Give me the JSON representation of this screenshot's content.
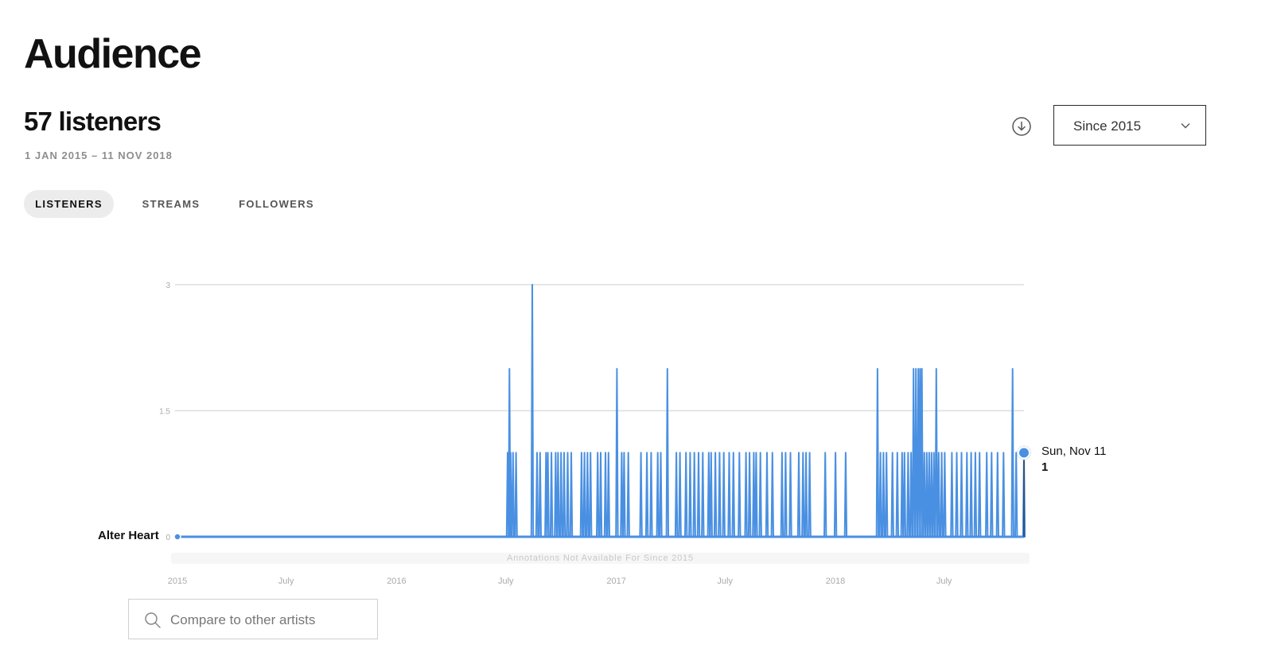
{
  "page": {
    "title": "Audience"
  },
  "summary": {
    "metric": "57 listeners",
    "date_range": "1 JAN 2015 – 11 NOV 2018"
  },
  "toolbar": {
    "download_icon": "download-circle-icon",
    "range_select": {
      "value": "Since 2015",
      "icon": "chevron-down-icon"
    }
  },
  "tabs": [
    {
      "label": "LISTENERS",
      "active": true
    },
    {
      "label": "STREAMS",
      "active": false
    },
    {
      "label": "FOLLOWERS",
      "active": false
    }
  ],
  "chart": {
    "series_label": "Alter Heart",
    "tooltip": {
      "date": "Sun, Nov 11",
      "value": "1"
    },
    "annotation_note": "Annotations Not Available For Since 2015"
  },
  "compare": {
    "placeholder": "Compare to other artists",
    "icon": "search-icon"
  },
  "colors": {
    "accent": "#4a90e2",
    "grid": "#dddddd",
    "text": "#181818"
  },
  "chart_data": {
    "type": "line",
    "title": "",
    "xlabel": "",
    "ylabel": "",
    "ylim": [
      0,
      3
    ],
    "y_ticks": [
      "0",
      "1.5",
      "3"
    ],
    "x_ticks": [
      "2015",
      "July",
      "2016",
      "July",
      "2017",
      "July",
      "2018",
      "July"
    ],
    "x_range": [
      "2015-01-01",
      "2018-11-11"
    ],
    "grid": true,
    "legend": "none",
    "series": [
      {
        "name": "Alter Heart",
        "baseline": 0,
        "default_value": 0,
        "points": [
          [
            "2016-07-04",
            1
          ],
          [
            "2016-07-07",
            2
          ],
          [
            "2016-07-09",
            1
          ],
          [
            "2016-07-13",
            1
          ],
          [
            "2016-07-18",
            1
          ],
          [
            "2016-08-14",
            3
          ],
          [
            "2016-08-22",
            1
          ],
          [
            "2016-08-27",
            1
          ],
          [
            "2016-09-06",
            1
          ],
          [
            "2016-09-09",
            1
          ],
          [
            "2016-09-15",
            1
          ],
          [
            "2016-09-22",
            1
          ],
          [
            "2016-09-26",
            1
          ],
          [
            "2016-10-01",
            1
          ],
          [
            "2016-10-06",
            1
          ],
          [
            "2016-10-12",
            1
          ],
          [
            "2016-10-18",
            1
          ],
          [
            "2016-11-04",
            1
          ],
          [
            "2016-11-09",
            1
          ],
          [
            "2016-11-14",
            1
          ],
          [
            "2016-11-19",
            1
          ],
          [
            "2016-12-01",
            1
          ],
          [
            "2016-12-06",
            1
          ],
          [
            "2016-12-14",
            1
          ],
          [
            "2016-12-19",
            1
          ],
          [
            "2017-01-02",
            2
          ],
          [
            "2017-01-10",
            1
          ],
          [
            "2017-01-14",
            1
          ],
          [
            "2017-01-21",
            1
          ],
          [
            "2017-02-11",
            1
          ],
          [
            "2017-02-21",
            1
          ],
          [
            "2017-02-28",
            1
          ],
          [
            "2017-03-11",
            1
          ],
          [
            "2017-03-16",
            1
          ],
          [
            "2017-03-27",
            2
          ],
          [
            "2017-04-11",
            1
          ],
          [
            "2017-04-17",
            1
          ],
          [
            "2017-04-27",
            1
          ],
          [
            "2017-05-04",
            1
          ],
          [
            "2017-05-11",
            1
          ],
          [
            "2017-05-18",
            1
          ],
          [
            "2017-05-25",
            1
          ],
          [
            "2017-06-04",
            1
          ],
          [
            "2017-06-08",
            1
          ],
          [
            "2017-06-15",
            1
          ],
          [
            "2017-06-22",
            1
          ],
          [
            "2017-06-29",
            1
          ],
          [
            "2017-07-08",
            1
          ],
          [
            "2017-07-15",
            1
          ],
          [
            "2017-07-25",
            1
          ],
          [
            "2017-08-05",
            1
          ],
          [
            "2017-08-11",
            1
          ],
          [
            "2017-08-18",
            1
          ],
          [
            "2017-08-22",
            1
          ],
          [
            "2017-08-29",
            1
          ],
          [
            "2017-09-09",
            1
          ],
          [
            "2017-09-18",
            1
          ],
          [
            "2017-10-04",
            1
          ],
          [
            "2017-10-10",
            1
          ],
          [
            "2017-10-18",
            1
          ],
          [
            "2017-11-01",
            1
          ],
          [
            "2017-11-08",
            1
          ],
          [
            "2017-11-13",
            1
          ],
          [
            "2017-11-19",
            1
          ],
          [
            "2017-12-15",
            1
          ],
          [
            "2018-01-01",
            1
          ],
          [
            "2018-01-18",
            1
          ],
          [
            "2018-03-12",
            2
          ],
          [
            "2018-03-17",
            1
          ],
          [
            "2018-03-22",
            1
          ],
          [
            "2018-03-27",
            1
          ],
          [
            "2018-04-06",
            1
          ],
          [
            "2018-04-14",
            1
          ],
          [
            "2018-04-22",
            1
          ],
          [
            "2018-04-26",
            1
          ],
          [
            "2018-05-02",
            1
          ],
          [
            "2018-05-07",
            1
          ],
          [
            "2018-05-11",
            2
          ],
          [
            "2018-05-15",
            2
          ],
          [
            "2018-05-19",
            2
          ],
          [
            "2018-05-22",
            2
          ],
          [
            "2018-05-25",
            2
          ],
          [
            "2018-05-29",
            1
          ],
          [
            "2018-06-02",
            1
          ],
          [
            "2018-06-06",
            1
          ],
          [
            "2018-06-10",
            1
          ],
          [
            "2018-06-14",
            1
          ],
          [
            "2018-06-18",
            2
          ],
          [
            "2018-06-22",
            1
          ],
          [
            "2018-06-27",
            1
          ],
          [
            "2018-07-02",
            1
          ],
          [
            "2018-07-14",
            1
          ],
          [
            "2018-07-22",
            1
          ],
          [
            "2018-07-30",
            1
          ],
          [
            "2018-08-08",
            1
          ],
          [
            "2018-08-15",
            1
          ],
          [
            "2018-08-22",
            1
          ],
          [
            "2018-08-29",
            1
          ],
          [
            "2018-09-10",
            1
          ],
          [
            "2018-09-18",
            1
          ],
          [
            "2018-09-28",
            1
          ],
          [
            "2018-10-08",
            1
          ],
          [
            "2018-10-23",
            2
          ],
          [
            "2018-10-29",
            1
          ],
          [
            "2018-11-11",
            1
          ]
        ]
      }
    ]
  }
}
